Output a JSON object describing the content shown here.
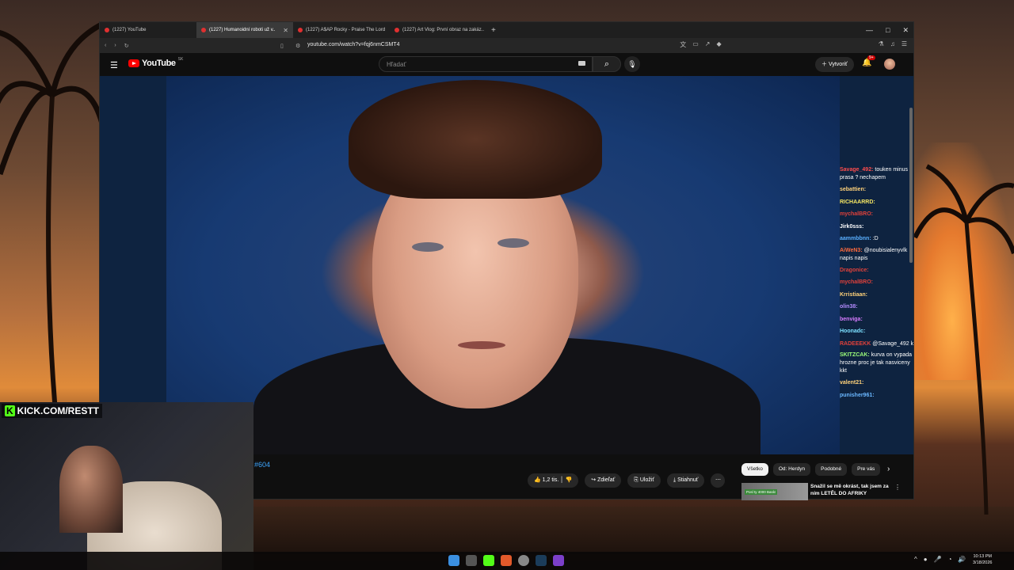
{
  "browser": {
    "tabs": [
      {
        "label": "(1227) YouTube",
        "active": false
      },
      {
        "label": "(1227) Humanoidní roboti už v..",
        "active": true
      },
      {
        "label": "(1227) A$AP Rocky - Praise The Lord",
        "active": false
      },
      {
        "label": "(1227) Art Vlog: První obraz na zakáz..",
        "active": false
      }
    ],
    "new_tab": "+",
    "window_controls": {
      "minimize": "—",
      "maximize": "□",
      "close": "✕"
    },
    "url": "youtube.com/watch?v=fqj6nmCSMT4"
  },
  "youtube": {
    "logo_text": "YouTube",
    "logo_region": "SK",
    "search_placeholder": "Hľadať",
    "create_label": "Vytvoriť",
    "notifications_badge": "9+",
    "hashtag": "#604",
    "actions": {
      "like_count": "1,2 tis.",
      "share": "Zdieľať",
      "save": "Uložiť",
      "download": "Stiahnuť"
    },
    "chips": [
      "Všetko",
      "Od: Herdyn",
      "Podobné",
      "Pre vás"
    ],
    "recommendation": {
      "thumb_tag": "Posl ty 4000 Barát",
      "title": "Snažil se mě okrást, tak jsem za ním LETĚL DO AFRIKY"
    }
  },
  "chat": [
    {
      "user": "Savage_492:",
      "color": "#ff4d4d",
      "text": "touken minus prasa ? nechapem",
      "wrap": true
    },
    {
      "user": "sebattien:",
      "color": "#ffd27a",
      "text": ""
    },
    {
      "user": "RICHAARRD:",
      "color": "#f5e663",
      "text": ""
    },
    {
      "user": "mychalBRO:",
      "color": "#e0413a",
      "text": ""
    },
    {
      "user": "Jirk0sss:",
      "color": "#ffffff",
      "text": ""
    },
    {
      "user": "aammbbnn:",
      "color": "#5ab0ff",
      "text": ":D"
    },
    {
      "user": "AiWeN3:",
      "color": "#ff6a3d",
      "text": "@noubisialenyvlk napis napis",
      "wrap": true
    },
    {
      "user": "Dragonice:",
      "color": "#e0413a",
      "text": ""
    },
    {
      "user": "mychalBRO:",
      "color": "#e0413a",
      "text": ""
    },
    {
      "user": "Krristiaan:",
      "color": "#ffd27a",
      "text": ""
    },
    {
      "user": "olin38:",
      "color": "#b58cff",
      "text": ""
    },
    {
      "user": "benviga:",
      "color": "#d77bff",
      "text": ""
    },
    {
      "user": "Hoonadc:",
      "color": "#7ce0ff",
      "text": ""
    },
    {
      "user": "RADEEEKK",
      "color": "#e0413a",
      "text": "@Savage_492 kkkk"
    },
    {
      "user": "SKITZCAK:",
      "color": "#9cff7a",
      "text": "kurva on vypada hrozne proc je tak nasviceny kkt",
      "wrap": true
    },
    {
      "user": "valent21:",
      "color": "#ffd27a",
      "text": ""
    },
    {
      "user": "punisher961:",
      "color": "#6ab7ff",
      "text": ""
    }
  ],
  "overlay": {
    "kick_logo": "K",
    "kick_text": "KICK.COM/RESTT"
  },
  "taskbar": {
    "time": "10:13 PM",
    "date": "3/18/2026"
  }
}
